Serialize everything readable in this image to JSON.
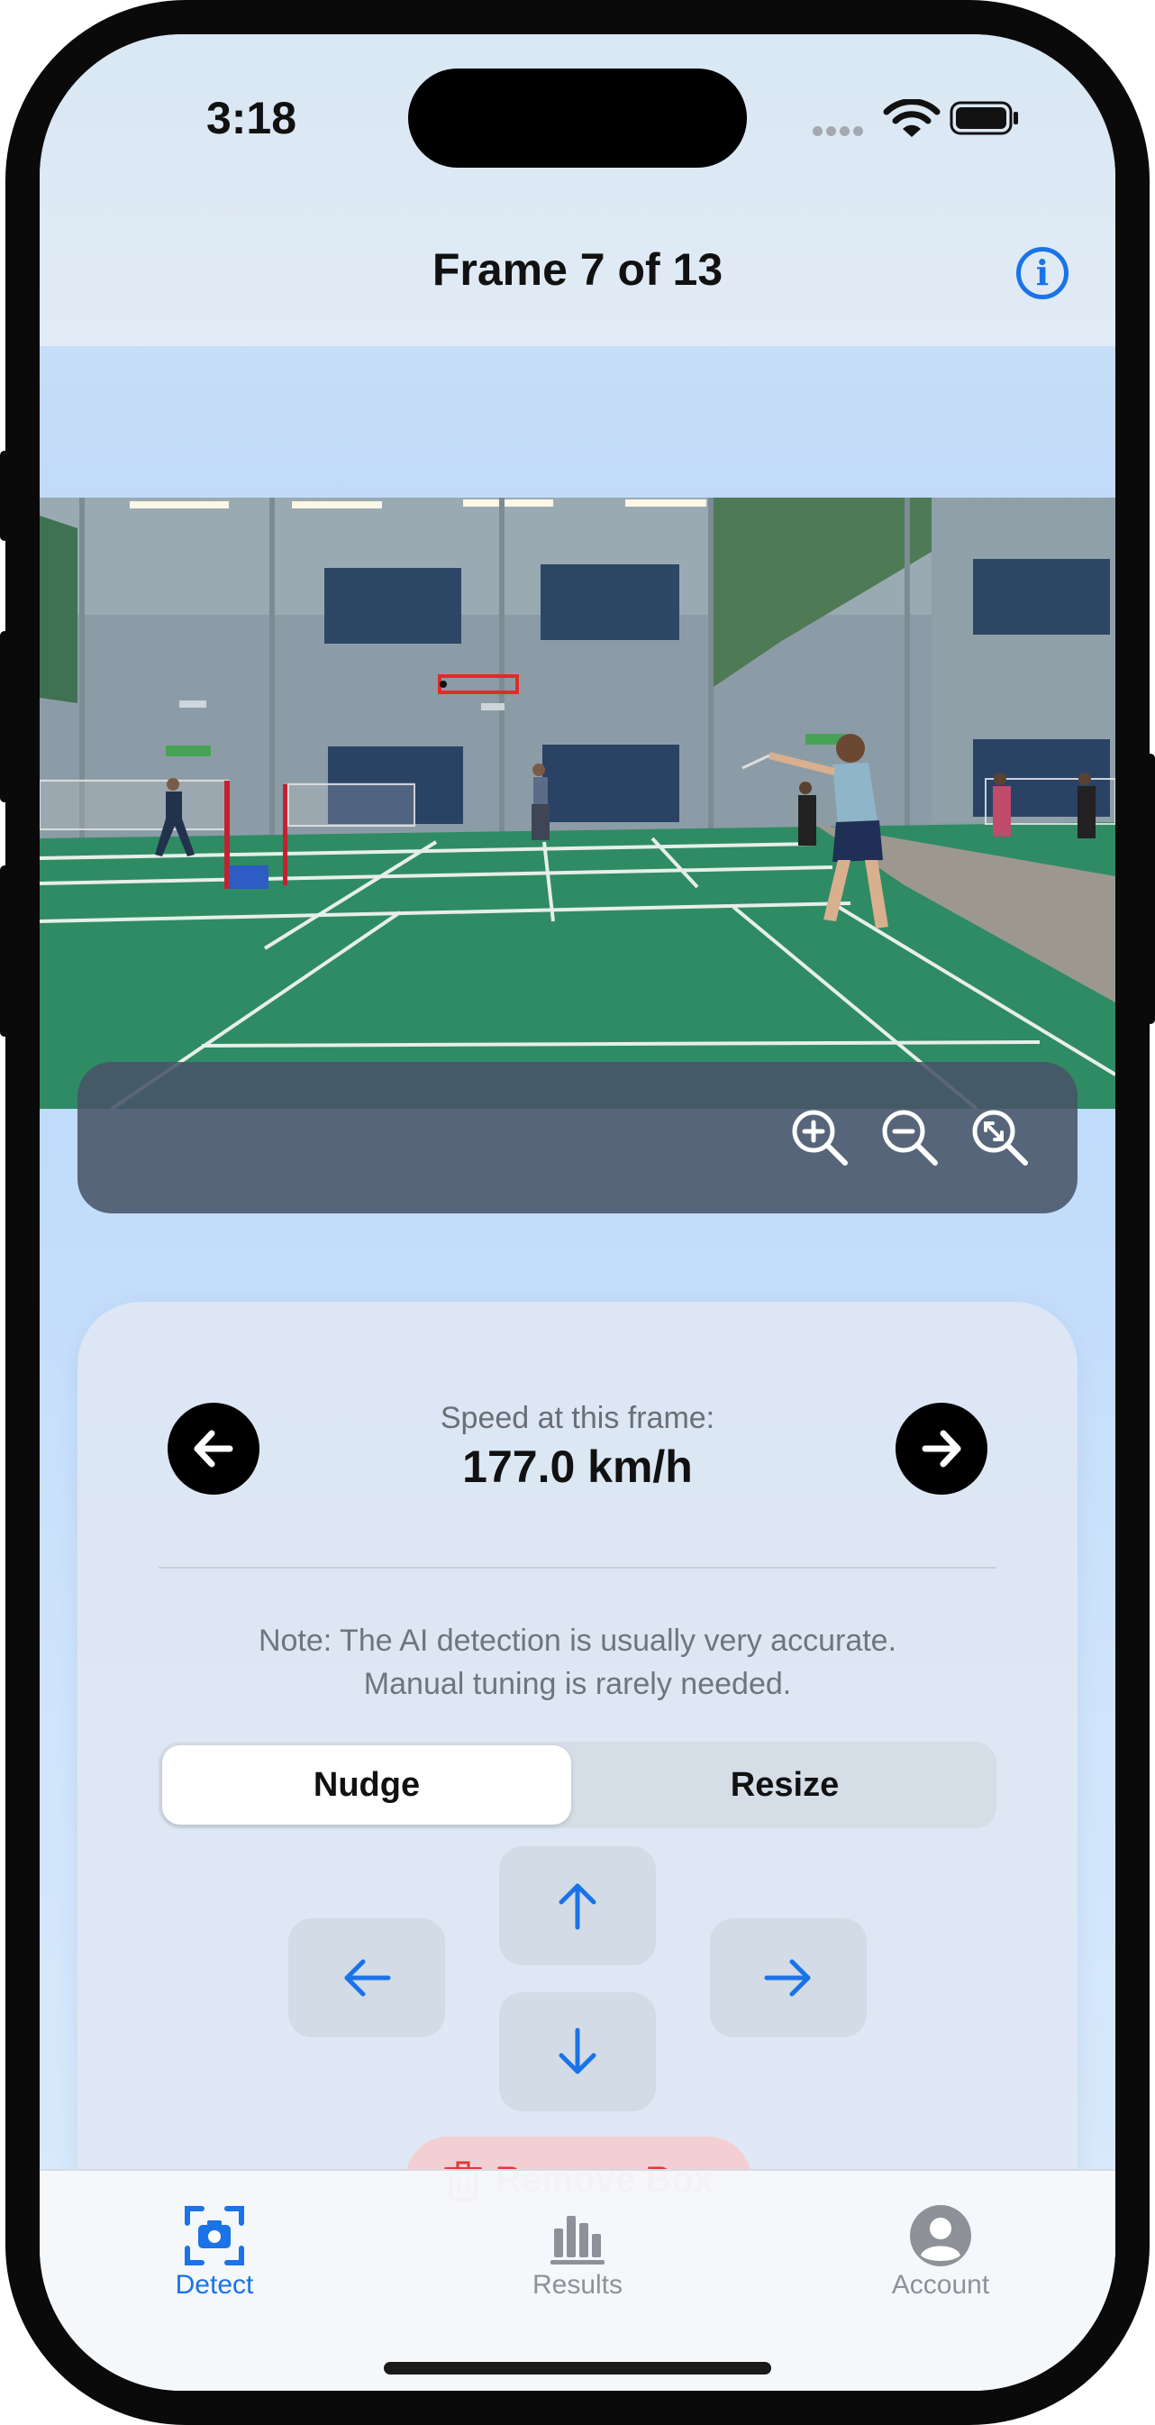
{
  "status_bar": {
    "time": "3:18"
  },
  "nav": {
    "title": "Frame 7 of 13"
  },
  "zoom": {
    "zoom_in": "zoom-in",
    "zoom_out": "zoom-out",
    "zoom_fit": "zoom-fit"
  },
  "detail": {
    "speed_label": "Speed at this frame:",
    "speed_value": "177.0 km/h",
    "note_line1": "Note: The AI detection is usually very accurate.",
    "note_line2": "Manual tuning is rarely needed.",
    "mode_options": [
      "Nudge",
      "Resize"
    ],
    "mode_selected": "Nudge",
    "remove_label": "Remove Box"
  },
  "tabs": [
    {
      "label": "Detect",
      "icon": "camera-icon",
      "selected": true
    },
    {
      "label": "Results",
      "icon": "bar-chart-icon",
      "selected": false
    },
    {
      "label": "Account",
      "icon": "person-icon",
      "selected": false
    }
  ],
  "colors": {
    "accent": "#1a73e8",
    "destructive": "#e0393b",
    "inactive": "#8e9298"
  }
}
